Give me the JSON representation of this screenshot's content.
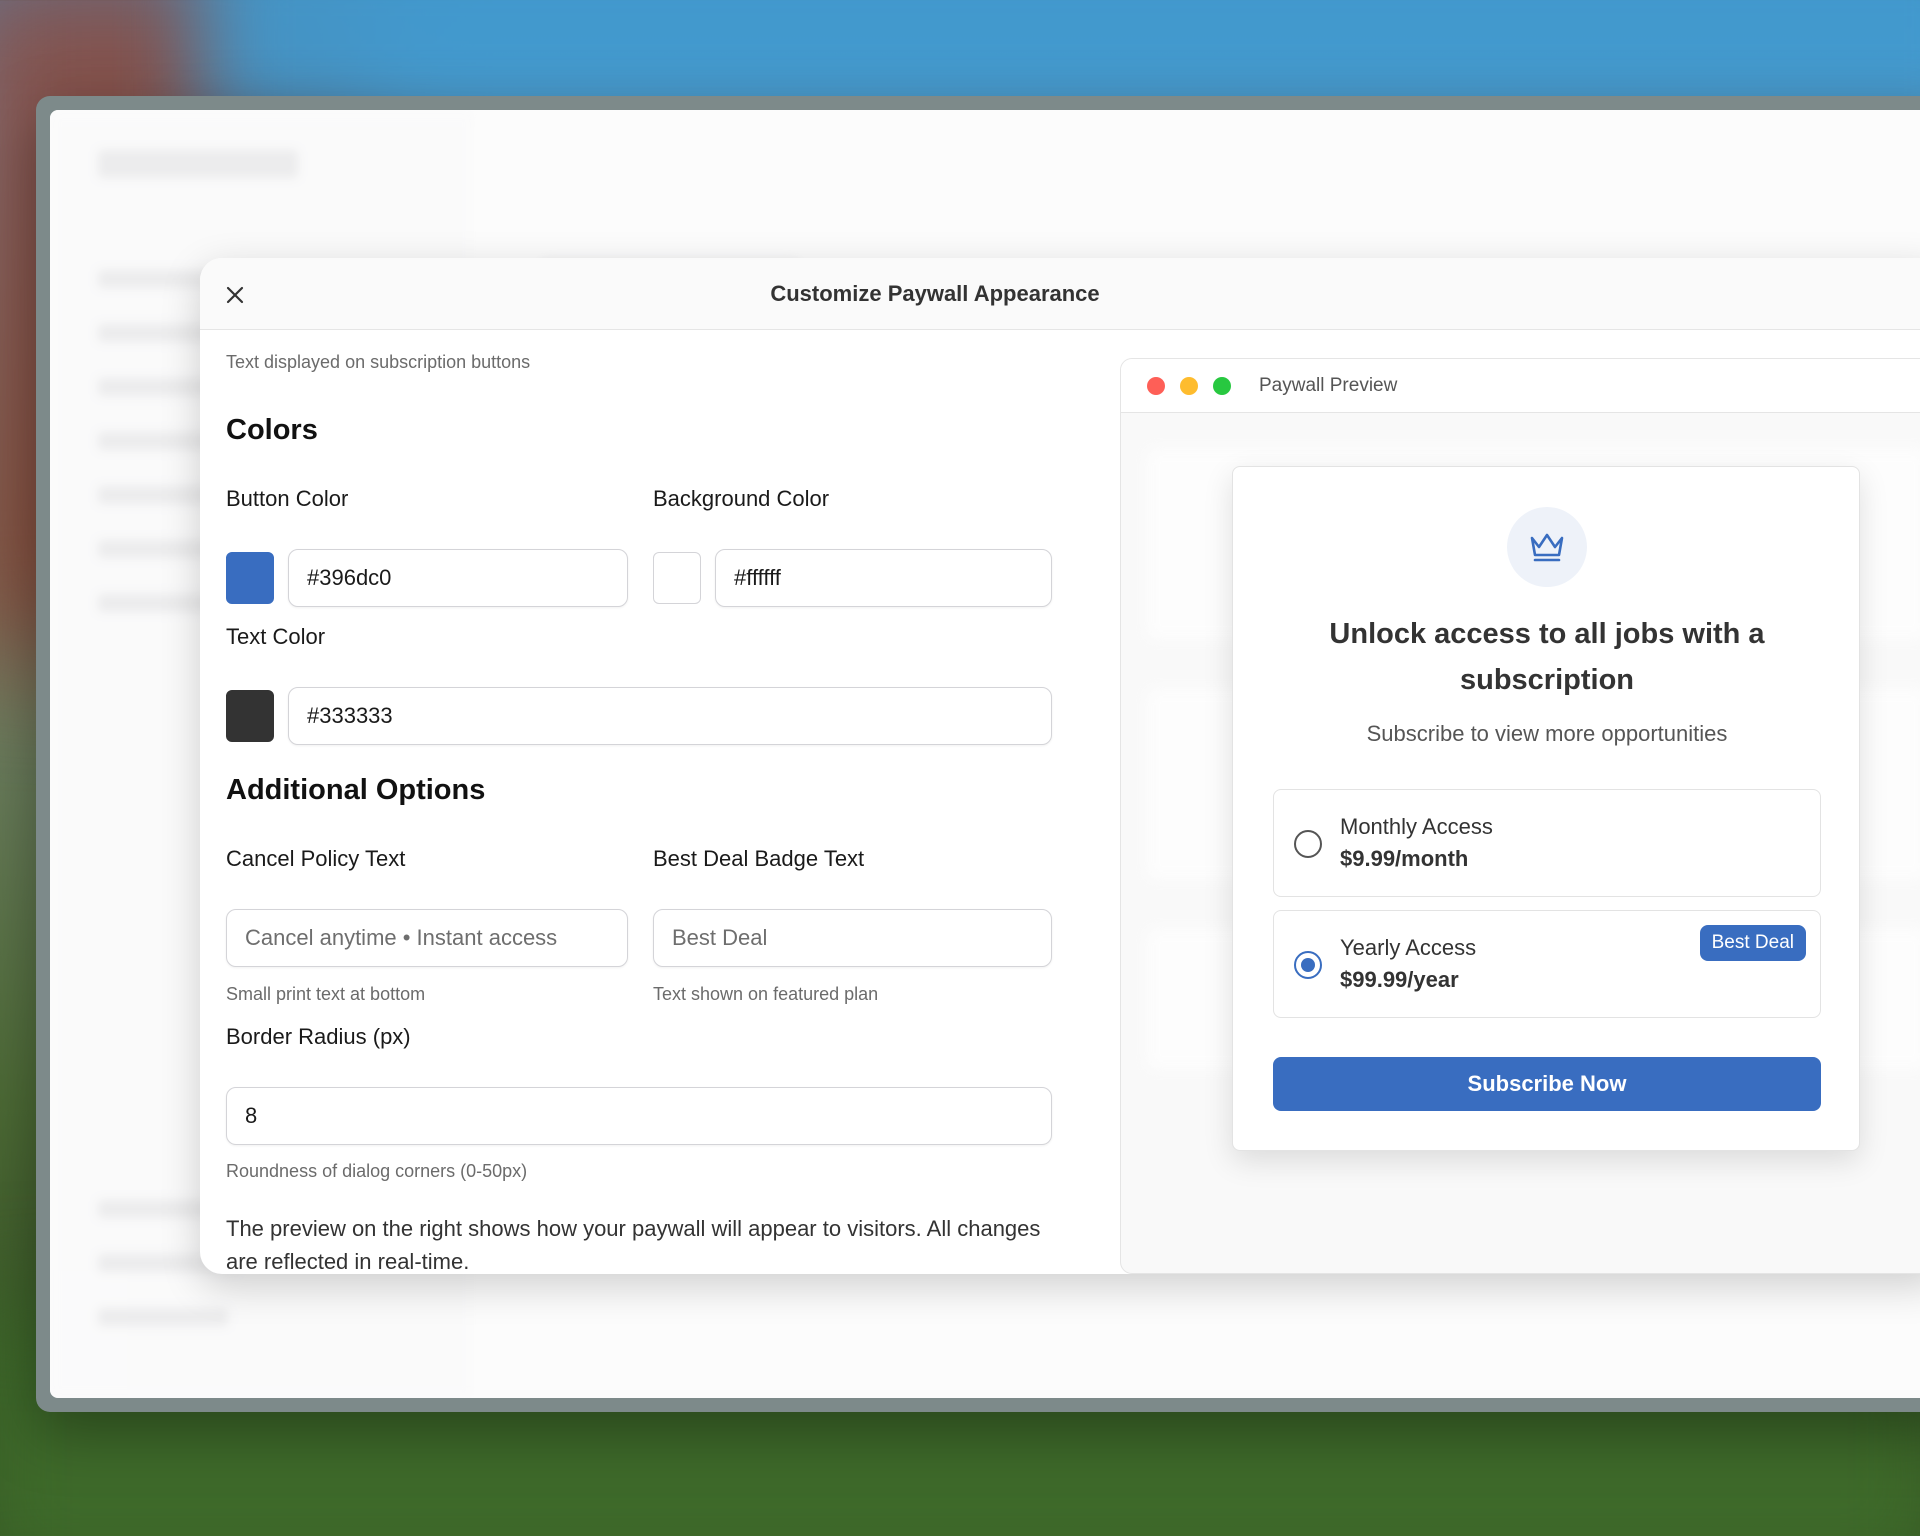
{
  "dialog": {
    "title": "Customize Paywall Appearance",
    "close_label": "×"
  },
  "form": {
    "button_text_hint": "Text displayed on subscription buttons",
    "colors": {
      "title": "Colors",
      "button_color": {
        "label": "Button Color",
        "value": "#396dc0",
        "swatch": "#396dc0"
      },
      "background_color": {
        "label": "Background Color",
        "value": "#ffffff",
        "swatch": "#ffffff"
      },
      "text_color": {
        "label": "Text Color",
        "value": "#333333",
        "swatch": "#333333"
      }
    },
    "additional": {
      "title": "Additional Options",
      "cancel_policy": {
        "label": "Cancel Policy Text",
        "placeholder": "Cancel anytime • Instant access",
        "hint": "Small print text at bottom"
      },
      "best_deal": {
        "label": "Best Deal Badge Text",
        "placeholder": "Best Deal",
        "hint": "Text shown on featured plan"
      },
      "border_radius": {
        "label": "Border Radius (px)",
        "value": "8",
        "hint": "Roundness of dialog corners (0-50px)"
      }
    },
    "footer_note": "The preview on the right shows how your paywall will appear to visitors. All changes are reflected in real-time."
  },
  "preview": {
    "window_title": "Paywall Preview",
    "paywall": {
      "title": "Unlock access to all jobs with a subscription",
      "subtitle": "Subscribe to view more opportunities",
      "plans": [
        {
          "name": "Monthly Access",
          "price": "$9.99/month",
          "selected": false
        },
        {
          "name": "Yearly Access",
          "price": "$99.99/year",
          "selected": true,
          "badge": "Best Deal"
        }
      ],
      "cta": "Subscribe Now"
    }
  },
  "colors": {
    "accent": "#396dc0",
    "traffic_red": "#fe5f57",
    "traffic_yellow": "#febc2e",
    "traffic_green": "#28c840"
  }
}
